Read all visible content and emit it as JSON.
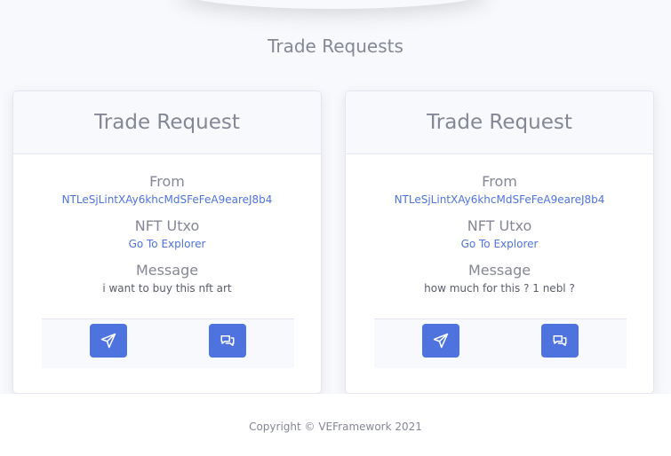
{
  "page": {
    "title": "Trade Requests"
  },
  "requests": [
    {
      "header": "Trade Request",
      "from_label": "From",
      "from_value": "NTLeSjLintXAy6khcMdSFeFeA9eareJ8b4",
      "utxo_label": "NFT Utxo",
      "utxo_link": "Go To Explorer",
      "message_label": "Message",
      "message_value": "i want to buy this nft art",
      "send_icon": "paper-plane-icon",
      "chat_icon": "comments-icon"
    },
    {
      "header": "Trade Request",
      "from_label": "From",
      "from_value": "NTLeSjLintXAy6khcMdSFeFeA9eareJ8b4",
      "utxo_label": "NFT Utxo",
      "utxo_link": "Go To Explorer",
      "message_label": "Message",
      "message_value": "how much for this ? 1 nebl ?",
      "send_icon": "paper-plane-icon",
      "chat_icon": "comments-icon"
    }
  ],
  "footer": {
    "copyright": "Copyright © VEFramework 2021"
  },
  "colors": {
    "primary": "#4e73df",
    "text": "#858796",
    "background": "#f8f9fc"
  }
}
